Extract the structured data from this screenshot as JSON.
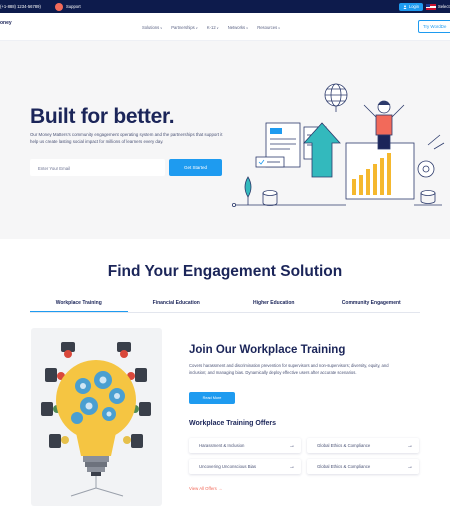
{
  "topbar": {
    "phone": "(+1-888) 1234-56789)",
    "support": "Support",
    "login": "Login",
    "language": "Select",
    "support_icon": "headset-icon",
    "login_icon": "user-icon",
    "language_icon": "us-flag-icon"
  },
  "nav": {
    "logo": "oney",
    "items": [
      "Solutions",
      "Partnerships",
      "K-12",
      "Networks",
      "Resources"
    ],
    "cta": "Try WordDe"
  },
  "hero": {
    "title": "Built for better.",
    "description": "Our Money Matters’s community engagement operating system and the partnerships that support it help us create lasting social impact for millions of learners every day.",
    "email_placeholder": "Enter Your Email",
    "cta": "Get Started"
  },
  "engagement": {
    "title": "Find Your Engagement Solution",
    "tabs": [
      "Workplace Training",
      "Financial Education",
      "Higher Education",
      "Community Engagement"
    ],
    "active_tab": "Workplace Training"
  },
  "workplace": {
    "title": "Join Our Workplace Training",
    "description": "Covers harassment and discrimination prevention for supervisors and non-supervisors; diversity, equity, and inclusion; and managing bias. Dynamically deploy effective users after accurate scenarios.",
    "read_more": "Read More",
    "offers_title": "Workplace Training Offers",
    "offers": [
      "Harassment & Inclusion",
      "Global Ethics & Compliance",
      "Uncovering Unconscious Bias",
      "Global Ethics & Compliance"
    ],
    "view_all": "View All Offers →"
  },
  "colors": {
    "brand_navy": "#0d1b4c",
    "accent_blue": "#1e9bf0",
    "accent_coral": "#f26a5a",
    "hero_bg": "#f6f6f7"
  }
}
